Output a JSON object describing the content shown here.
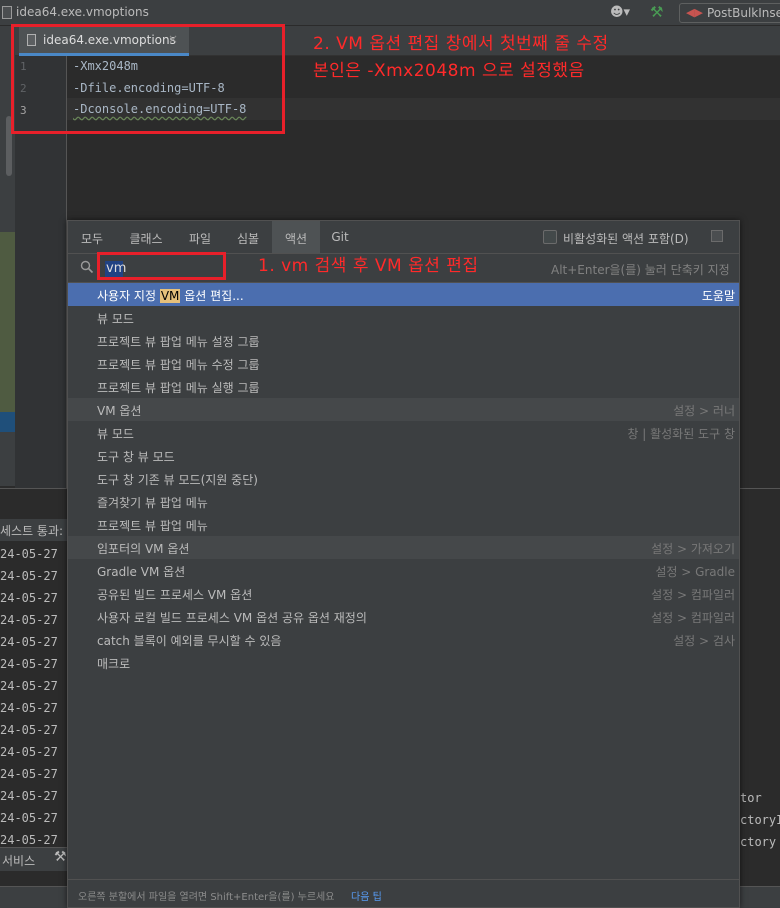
{
  "window": {
    "title": "idea64.exe.vmoptions",
    "run_config": "PostBulkInsert"
  },
  "editor": {
    "tab_label": "idea64.exe.vmoptions",
    "close_glyph": "×",
    "line_numbers": [
      "1",
      "2",
      "3"
    ],
    "lines": [
      "-Xmx2048m",
      "-Dfile.encoding=UTF-8",
      "-Dconsole.encoding=UTF-8"
    ]
  },
  "annotations": {
    "step2_line1": "2. VM 옵션 편집 창에서 첫번째 줄 수정",
    "step2_line2": "본인은 -Xmx2048m 으로 설정했음",
    "step1": "1. vm 검색 후 VM 옵션 편집"
  },
  "background": {
    "panel_header": "세스트 통과:",
    "log_lines": [
      "24-05-27",
      "24-05-27",
      "24-05-27",
      "24-05-27",
      "24-05-27",
      "24-05-27",
      "24-05-27",
      "24-05-27",
      "24-05-27",
      "24-05-27",
      "24-05-27",
      "24-05-27",
      "24-05-27",
      "24-05-27"
    ],
    "right_log": [
      "tor",
      "ctoryI",
      "ctory"
    ],
    "services_label": "서비스"
  },
  "popup": {
    "tabs": [
      "모두",
      "클래스",
      "파일",
      "심볼",
      "액션",
      "Git"
    ],
    "active_tab": "액션",
    "include_inactive_label": "비활성화된 액션 포함(D)",
    "search_value": "vm",
    "search_hint": "Alt+Enter을(를) 눌러 단축키 지정",
    "results": [
      {
        "prefix": "사용자 지정 ",
        "match": "VM",
        "suffix": " 옵션 편집...",
        "location": "도움말",
        "selected": true
      },
      {
        "label": "뷰 모드",
        "location": ""
      },
      {
        "label": "프로젝트 뷰 팝업 메뉴 설정 그룹",
        "location": ""
      },
      {
        "label": "프로젝트 뷰 팝업 메뉴 수정 그룹",
        "location": ""
      },
      {
        "label": "프로젝트 뷰 팝업 메뉴 실행 그룹",
        "location": ""
      },
      {
        "label": "VM 옵션",
        "location": "설정 > 러너",
        "group": true
      },
      {
        "label": "뷰 모드",
        "location": "창 | 활성화된 도구 창"
      },
      {
        "label": "도구 창 뷰 모드",
        "location": ""
      },
      {
        "label": "도구 창 기존 뷰 모드(지원 중단)",
        "location": ""
      },
      {
        "label": "즐겨찾기 뷰 팝업 메뉴",
        "location": ""
      },
      {
        "label": "프로젝트 뷰 팝업 메뉴",
        "location": ""
      },
      {
        "label": "임포터의 VM 옵션",
        "location": "설정 > 가져오기",
        "group": true
      },
      {
        "label": "Gradle VM 옵션",
        "location": "설정 > Gradle"
      },
      {
        "label": "공유된 빌드 프로세스 VM 옵션",
        "location": "설정 > 컴파일러"
      },
      {
        "label": "사용자 로컬 빌드 프로세스 VM 옵션 공유 옵션 재정의",
        "location": "설정 > 컴파일러"
      },
      {
        "label": "catch 블록이 예외를 무시할 수 있음",
        "location": "설정 > 검사"
      },
      {
        "label": "매크로",
        "location": ""
      }
    ],
    "footer_text": "오른쪽 분할에서 파일을 열려면 Shift+Enter을(를) 누르세요",
    "footer_link": "다음 팁"
  },
  "colors": {
    "annotation_red": "#e8202a",
    "selection_blue": "#4b6eaf",
    "match_highlight": "#e5c07b"
  }
}
